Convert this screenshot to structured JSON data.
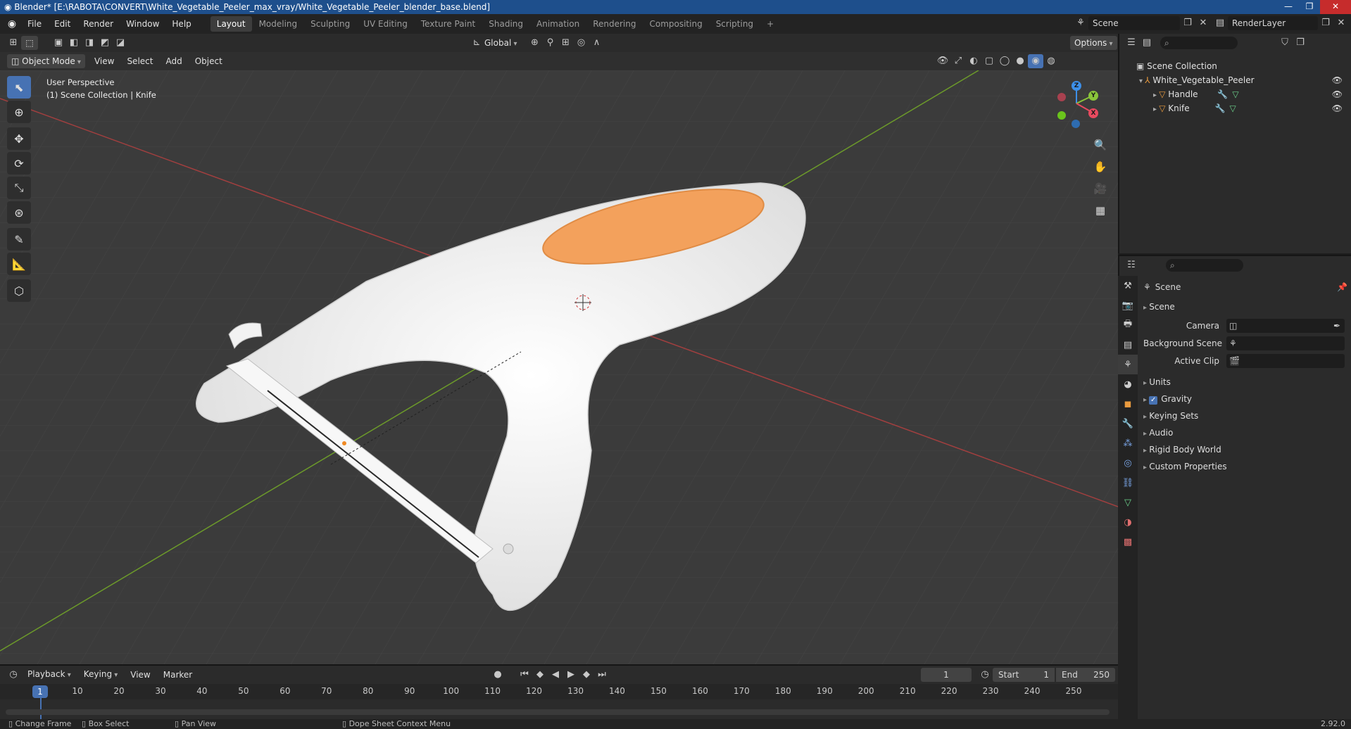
{
  "window": {
    "title": "Blender* [E:\\RABOTA\\CONVERT\\White_Vegetable_Peeler_max_vray/White_Vegetable_Peeler_blender_base.blend]"
  },
  "menu": [
    "File",
    "Edit",
    "Render",
    "Window",
    "Help"
  ],
  "workspaces": [
    "Layout",
    "Modeling",
    "Sculpting",
    "UV Editing",
    "Texture Paint",
    "Shading",
    "Animation",
    "Rendering",
    "Compositing",
    "Scripting"
  ],
  "active_workspace": "Layout",
  "scene_selector": {
    "value": "Scene"
  },
  "renderlayer_selector": {
    "value": "RenderLayer"
  },
  "header": {
    "transform_orientation": "Global",
    "options_label": "Options"
  },
  "viewport_header": {
    "mode": "Object Mode",
    "menus": [
      "View",
      "Select",
      "Add",
      "Object"
    ]
  },
  "viewport": {
    "perspective_label": "User Perspective",
    "collection_label": "(1) Scene Collection | Knife"
  },
  "gizmo": {
    "x": "X",
    "y": "Y",
    "z": "Z",
    "colors": {
      "x": "#e84a5f",
      "y": "#8ac43a",
      "z": "#3d8fe8"
    }
  },
  "outliner": {
    "root": "Scene Collection",
    "items": [
      {
        "name": "White_Vegetable_Peeler",
        "level": 1
      },
      {
        "name": "Handle",
        "level": 2
      },
      {
        "name": "Knife",
        "level": 2
      }
    ]
  },
  "properties": {
    "context_title": "Scene",
    "panel_title": "Scene",
    "fields": [
      {
        "label": "Camera",
        "value": ""
      },
      {
        "label": "Background Scene",
        "value": ""
      },
      {
        "label": "Active Clip",
        "value": ""
      }
    ],
    "sections": [
      "Units",
      "Gravity",
      "Keying Sets",
      "Audio",
      "Rigid Body World",
      "Custom Properties"
    ],
    "gravity_checked": true
  },
  "timeline": {
    "menus": [
      "Playback",
      "Keying",
      "View",
      "Marker"
    ],
    "current_frame": "1",
    "start_label": "Start",
    "start": "1",
    "end_label": "End",
    "end": "250",
    "ticks": [
      "1",
      "10",
      "20",
      "30",
      "40",
      "50",
      "60",
      "70",
      "80",
      "90",
      "100",
      "110",
      "120",
      "130",
      "140",
      "150",
      "160",
      "170",
      "180",
      "190",
      "200",
      "210",
      "220",
      "230",
      "240",
      "250"
    ]
  },
  "statusbar": {
    "items": [
      "Change Frame",
      "Box Select",
      "Pan View",
      "Dope Sheet Context Menu"
    ],
    "version": "2.92.0"
  },
  "colors": {
    "accent": "#4772b3",
    "object_orange": "#f3a15c",
    "peeler_white": "#f4f4f4",
    "x_axis": "#c24a4a",
    "y_axis": "#6c9a2a"
  }
}
